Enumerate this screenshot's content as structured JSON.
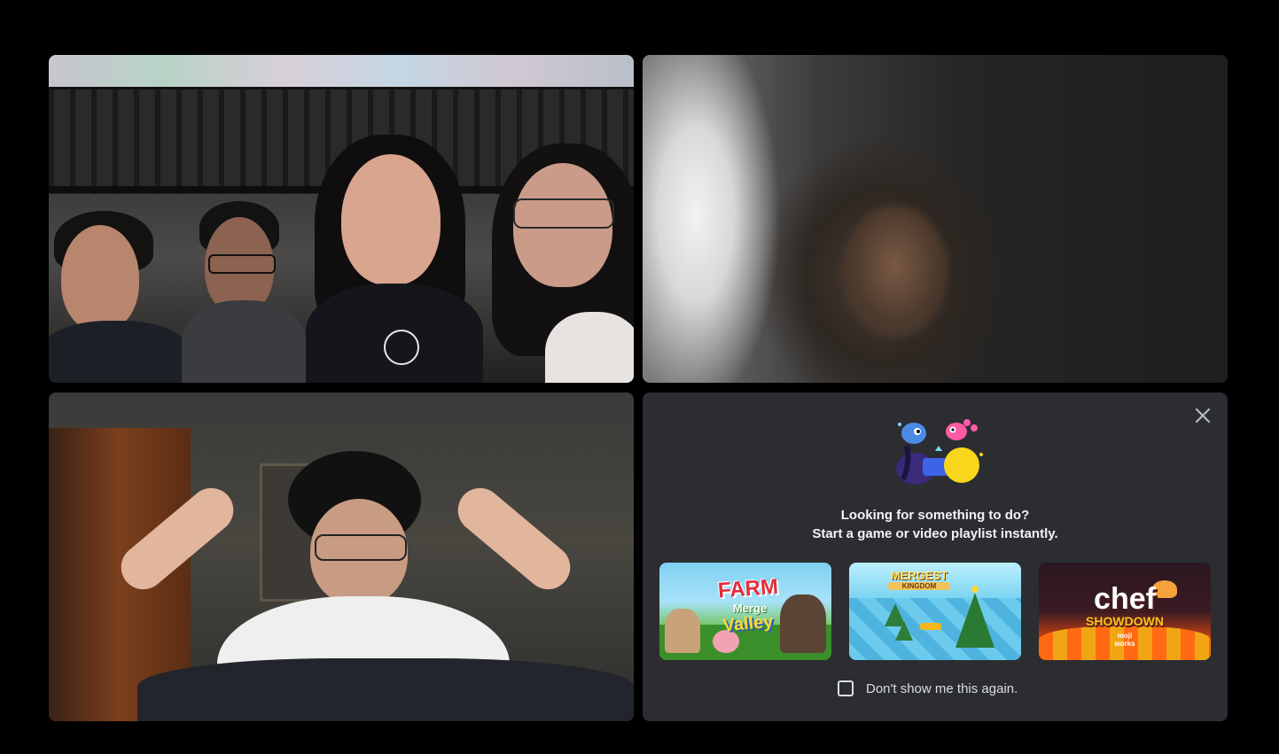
{
  "call": {
    "participants": [
      {
        "tile": "video-1",
        "description_visible": false
      },
      {
        "tile": "video-2",
        "description_visible": false
      },
      {
        "tile": "video-3",
        "description_visible": false
      }
    ]
  },
  "activity_panel": {
    "close_icon": "close-icon",
    "headline": "Looking for something to do?",
    "subline": "Start a game or video playlist instantly.",
    "activities": [
      {
        "title": "FARM",
        "line2": "Merge",
        "line3": "Valley",
        "accent": "#e52b3a"
      },
      {
        "title": "MERGEST",
        "line2": "KINGDOM",
        "accent": "#4fb6e3"
      },
      {
        "title": "chef",
        "line2": "SHOWDOWN",
        "brand": "moji works",
        "accent": "#d24510"
      }
    ],
    "dont_show_label": "Don't show me this again.",
    "dont_show_checked": false
  },
  "colors": {
    "background": "#000000",
    "panel": "#2b2d31",
    "text": "#f2f3f5"
  }
}
